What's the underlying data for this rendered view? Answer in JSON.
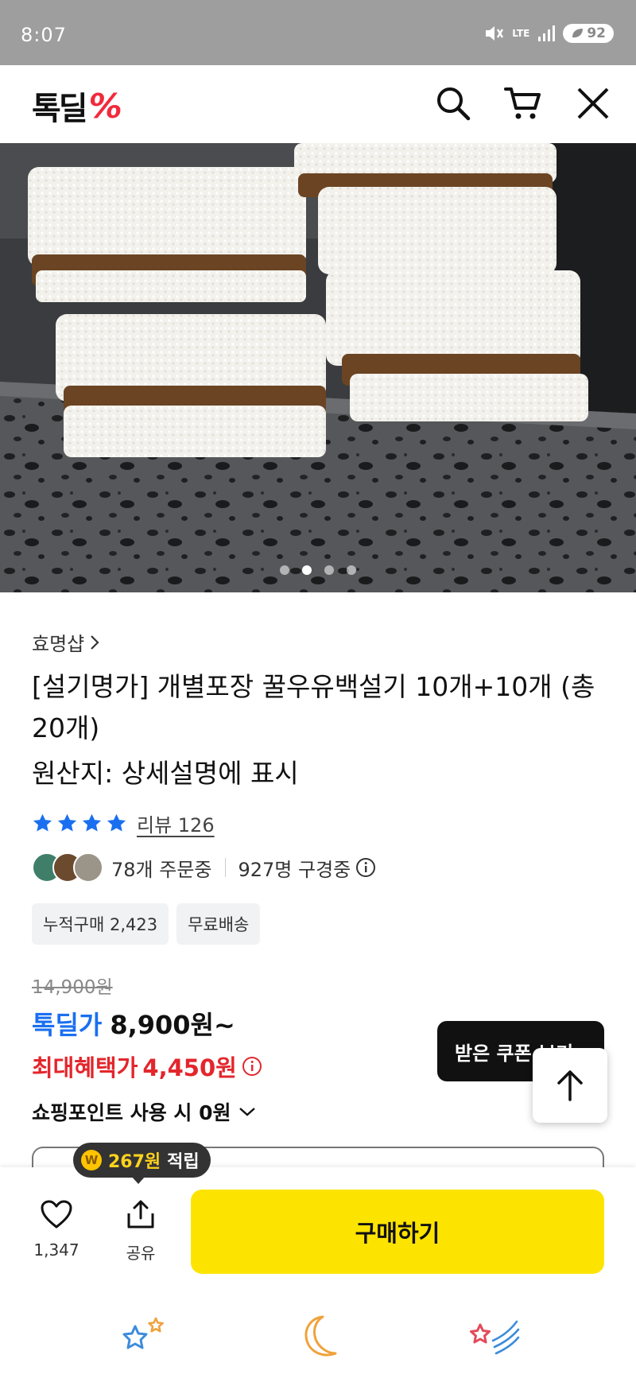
{
  "status_bar": {
    "time": "8:07",
    "network": "LTE",
    "battery": "92"
  },
  "header": {
    "logo_text": "톡딜",
    "logo_mark": "%"
  },
  "hero": {
    "slide_count": 4,
    "active_slide": 1
  },
  "product": {
    "shop_name": "효명샵",
    "title": "[설기명가] 개별포장 꿀우유백설기 10개+10개 (총20개)",
    "origin": "원산지: 상세설명에 표시",
    "rating_stars": 4,
    "review_label": "리뷰 126",
    "orders_text": "78개 주문중",
    "viewers_text": "927명 구경중",
    "chips": [
      "누적구매 2,423",
      "무료배송"
    ],
    "original_price": "14,900원",
    "deal_label": "톡딜가",
    "deal_price": "8,900원~",
    "max_benefit_label": "최대혜택가",
    "max_benefit_price": "4,450원",
    "shopping_point": "쇼핑포인트 사용 시 0원"
  },
  "coupon_button": "받은 쿠폰 보기",
  "points_tooltip": {
    "coin": "W",
    "amount": "267원",
    "label": "적립"
  },
  "bottom_bar": {
    "like_count": "1,347",
    "share_label": "공유",
    "buy_label": "구매하기"
  },
  "colors": {
    "accent_blue": "#1a6ff0",
    "accent_red": "#e3262c",
    "buy_yellow": "#fde400",
    "logo_red": "#f22a3c"
  }
}
